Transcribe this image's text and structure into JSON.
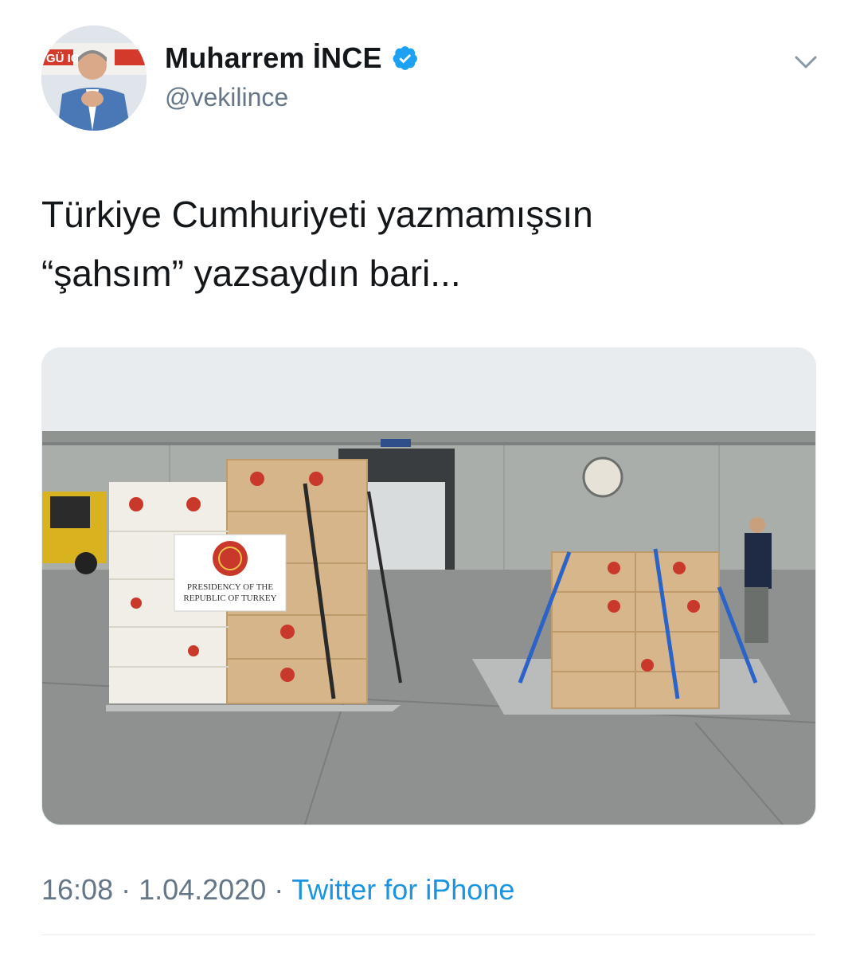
{
  "author": {
    "display_name": "Muharrem İNCE",
    "handle": "@vekilince",
    "verified": true,
    "avatar_banner_text": "GÜ   ICE"
  },
  "tweet": {
    "text_lines": [
      "Türkiye Cumhuriyeti yazmamışsın",
      "“şahsım” yazsaydın bari..."
    ],
    "media": {
      "description_icon": "photo-of-aid-pallets",
      "label_line_1": "PRESIDENCY OF THE",
      "label_line_2": "REPUBLIC OF TURKEY"
    }
  },
  "meta": {
    "time": "16:08",
    "separator": "·",
    "date": "1.04.2020",
    "source": "Twitter for iPhone"
  },
  "colors": {
    "text": "#14171a",
    "secondary": "#657786",
    "link": "#1b95e0",
    "verified": "#1da1f2",
    "border": "#e6ecf0"
  }
}
